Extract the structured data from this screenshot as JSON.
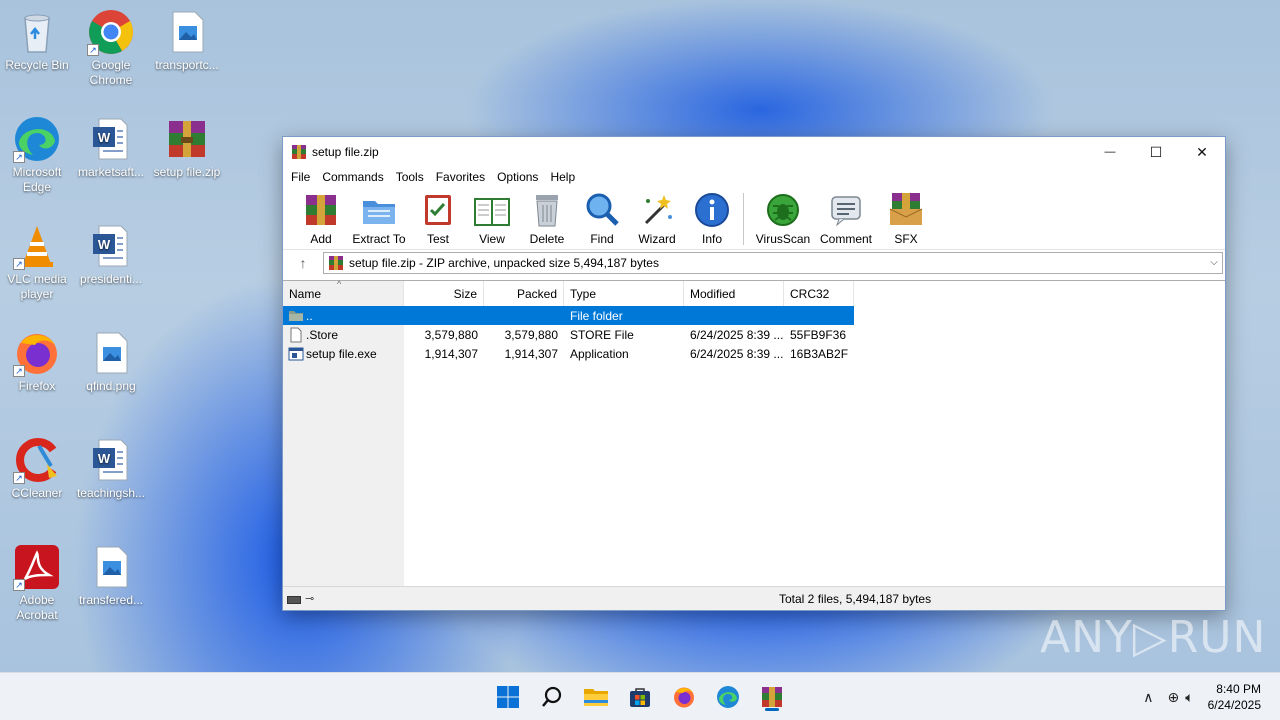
{
  "desktop": {
    "icons": [
      {
        "label": "Recycle Bin",
        "icon": "recycle-bin-icon"
      },
      {
        "label": "Google Chrome",
        "icon": "chrome-icon"
      },
      {
        "label": "transportc...",
        "icon": "image-file-icon"
      },
      {
        "label": "Microsoft Edge",
        "icon": "edge-icon"
      },
      {
        "label": "marketsaft...",
        "icon": "word-doc-icon"
      },
      {
        "label": "setup file.zip",
        "icon": "winrar-archive-icon"
      },
      {
        "label": "VLC media player",
        "icon": "vlc-icon"
      },
      {
        "label": "presidenti...",
        "icon": "word-doc-icon"
      },
      {
        "label": "Firefox",
        "icon": "firefox-icon"
      },
      {
        "label": "qfind.png",
        "icon": "image-file-icon"
      },
      {
        "label": "CCleaner",
        "icon": "ccleaner-icon"
      },
      {
        "label": "teachingsh...",
        "icon": "word-doc-icon"
      },
      {
        "label": "Adobe Acrobat",
        "icon": "acrobat-icon"
      },
      {
        "label": "transfered...",
        "icon": "image-file-icon"
      }
    ]
  },
  "window": {
    "title": "setup file.zip",
    "controls": {
      "minimize": "—",
      "maximize": "☐",
      "close": "✕"
    },
    "menu": [
      "File",
      "Commands",
      "Tools",
      "Favorites",
      "Options",
      "Help"
    ],
    "toolbar": [
      "Add",
      "Extract To",
      "Test",
      "View",
      "Delete",
      "Find",
      "Wizard",
      "Info",
      "VirusScan",
      "Comment",
      "SFX"
    ],
    "address": "setup file.zip - ZIP archive, unpacked size 5,494,187 bytes",
    "columns": {
      "name": "Name",
      "size": "Size",
      "packed": "Packed",
      "type": "Type",
      "modified": "Modified",
      "crc": "CRC32"
    },
    "rows": [
      {
        "name": "..",
        "size": "",
        "packed": "",
        "type": "File folder",
        "modified": "",
        "crc": "",
        "icon": "folder-icon"
      },
      {
        "name": ".Store",
        "size": "3,579,880",
        "packed": "3,579,880",
        "type": "STORE File",
        "modified": "6/24/2025 8:39 ...",
        "crc": "55FB9F36",
        "icon": "blank-file-icon"
      },
      {
        "name": "setup file.exe",
        "size": "1,914,307",
        "packed": "1,914,307",
        "type": "Application",
        "modified": "6/24/2025 8:39 ...",
        "crc": "16B3AB2F",
        "icon": "exe-file-icon"
      }
    ],
    "status": "Total 2 files, 5,494,187 bytes"
  },
  "taskbar": {
    "apps": [
      "start-icon",
      "search-icon",
      "file-explorer-icon",
      "store-icon",
      "firefox-icon",
      "edge-icon",
      "winrar-icon"
    ],
    "clock": {
      "time": "8:40 PM",
      "date": "6/24/2025"
    }
  },
  "watermark": "ANY▷RUN",
  "colors": {
    "selection": "#0078d7",
    "accent": "#0067c0"
  }
}
